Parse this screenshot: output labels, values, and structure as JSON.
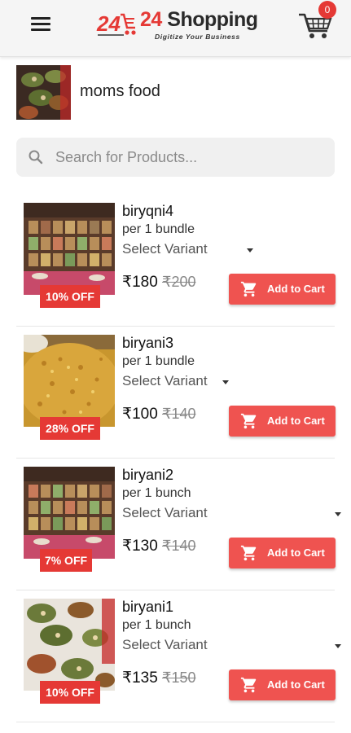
{
  "header": {
    "logo_mark": "24",
    "logo_title": "Shopping",
    "logo_title_prefix": "24",
    "tagline": "Digitize Your Business",
    "cart_count": "0",
    "brand_color": "#e53935"
  },
  "store": {
    "name": "moms food"
  },
  "search": {
    "placeholder": "Search for Products..."
  },
  "products": [
    {
      "name": "biryqni4",
      "unit": "per 1 bundle",
      "variant": "Select Variant",
      "price": "₹180",
      "mrp": "₹200",
      "discount": "10% OFF",
      "button": "Add to Cart"
    },
    {
      "name": "biryani3",
      "unit": "per 1 bundle",
      "variant": "Select Variant",
      "price": "₹100",
      "mrp": "₹140",
      "discount": "28% OFF",
      "button": "Add to Cart"
    },
    {
      "name": "biryani2",
      "unit": "per 1 bunch",
      "variant": "Select Variant",
      "price": "₹130",
      "mrp": "₹140",
      "discount": "7% OFF",
      "button": "Add to Cart"
    },
    {
      "name": "biryani1",
      "unit": "per 1 bunch",
      "variant": "Select Variant",
      "price": "₹135",
      "mrp": "₹150",
      "discount": "10% OFF",
      "button": "Add to Cart"
    }
  ]
}
